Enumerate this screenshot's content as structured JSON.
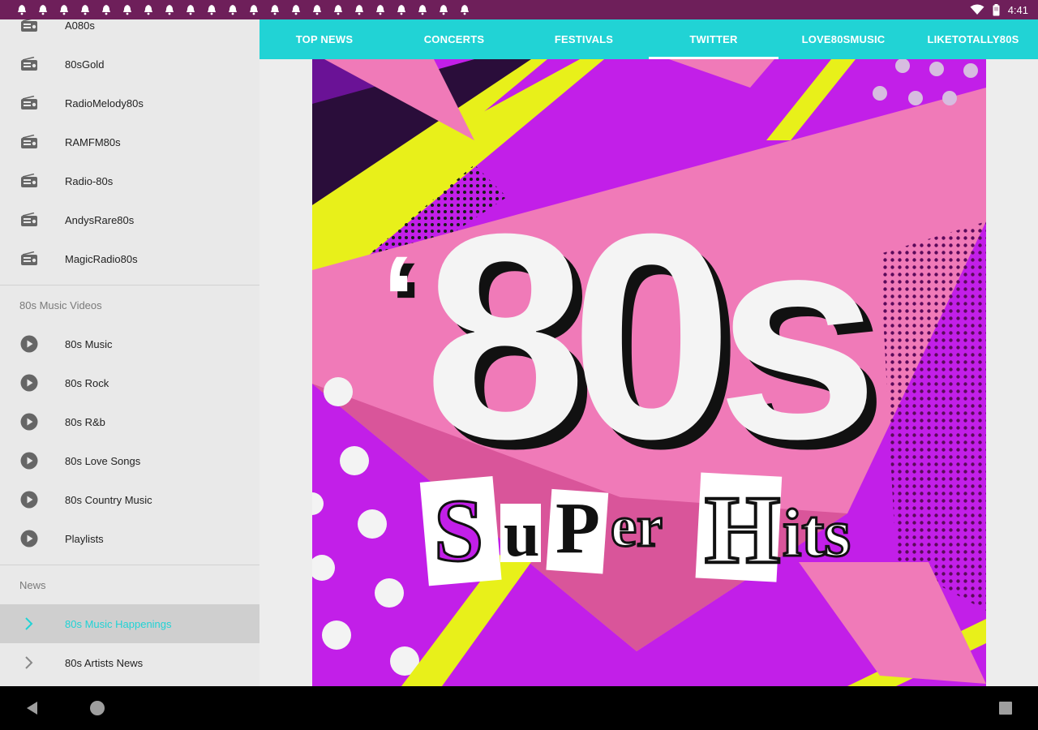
{
  "status": {
    "time": "4:41",
    "notification_count": 22
  },
  "sidebar": {
    "radio_items": [
      {
        "label": "A080s",
        "icon": "radio-icon"
      },
      {
        "label": "80sGold",
        "icon": "radio-icon"
      },
      {
        "label": "RadioMelody80s",
        "icon": "radio-icon"
      },
      {
        "label": "RAMFM80s",
        "icon": "radio-icon"
      },
      {
        "label": "Radio-80s",
        "icon": "radio-icon"
      },
      {
        "label": "AndysRare80s",
        "icon": "radio-icon"
      },
      {
        "label": "MagicRadio80s",
        "icon": "radio-icon"
      }
    ],
    "videos_section": "80s Music Videos",
    "video_items": [
      {
        "label": "80s Music",
        "icon": "play-icon"
      },
      {
        "label": "80s Rock",
        "icon": "play-icon"
      },
      {
        "label": "80s R&b",
        "icon": "play-icon"
      },
      {
        "label": "80s Love Songs",
        "icon": "play-icon"
      },
      {
        "label": "80s Country Music",
        "icon": "play-icon"
      },
      {
        "label": "Playlists",
        "icon": "play-icon"
      }
    ],
    "news_section": "News",
    "news_items": [
      {
        "label": "80s Music Happenings",
        "icon": "chevron-right-icon",
        "active": true
      },
      {
        "label": "80s Artists News",
        "icon": "chevron-right-icon",
        "active": false
      }
    ]
  },
  "tabs": [
    {
      "label": "TOP NEWS"
    },
    {
      "label": "CONCERTS"
    },
    {
      "label": "FESTIVALS"
    },
    {
      "label": "TWITTER",
      "active": true
    },
    {
      "label": "LOVE80SMUSIC"
    },
    {
      "label": "LIKETOTALLY80S"
    }
  ],
  "artwork": {
    "headline": "80s",
    "apostrophe": "‘",
    "subtitle_parts": [
      "S",
      "u",
      "P",
      "er",
      "H",
      "its"
    ]
  },
  "colors": {
    "status_bar": "#6e1f5a",
    "accent": "#21d3d5",
    "art_purple": "#c21fe8",
    "art_pink": "#f07ab8",
    "art_yellow": "#e8f01a"
  }
}
